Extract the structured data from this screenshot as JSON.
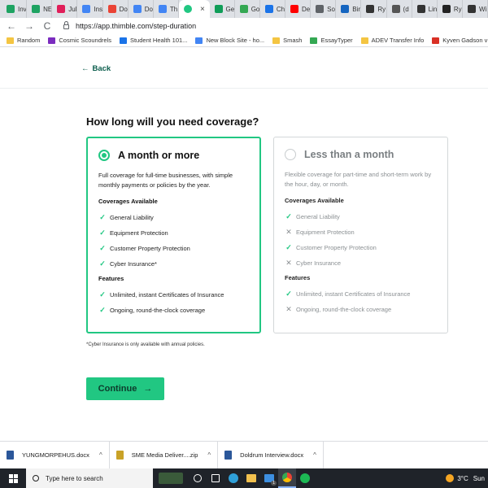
{
  "browser": {
    "tabs": [
      {
        "label": "Inv",
        "color": "#1ea362"
      },
      {
        "label": "NE",
        "color": "#1ea362"
      },
      {
        "label": "Jul",
        "color": "#e01e5a"
      },
      {
        "label": "Ins",
        "color": "#4285f4"
      },
      {
        "label": "Do",
        "color": "#ea4335"
      },
      {
        "label": "Do",
        "color": "#4285f4"
      },
      {
        "label": "Th",
        "color": "#4285f4"
      },
      {
        "label": "",
        "color": "#21c782",
        "active": true
      },
      {
        "label": "Ge",
        "color": "#0f9d58"
      },
      {
        "label": "Go",
        "color": "#34a853"
      },
      {
        "label": "Ch",
        "color": "#1a73e8"
      },
      {
        "label": "De",
        "color": "#ff0000"
      },
      {
        "label": "So",
        "color": "#5f6368"
      },
      {
        "label": "Bir",
        "color": "#1565c0"
      },
      {
        "label": "Ry",
        "color": "#333333"
      },
      {
        "label": "(d",
        "color": "#555555"
      },
      {
        "label": "Lin",
        "color": "#333333"
      },
      {
        "label": "Ry",
        "color": "#222222"
      },
      {
        "label": "Wi",
        "color": "#333333"
      }
    ],
    "active_tab_close": "×",
    "nav_back": "←",
    "nav_forward": "→",
    "nav_reload": "C",
    "url": "https://app.thimble.com/step-duration",
    "bookmarks": [
      {
        "label": "Random",
        "color": "#f4c542"
      },
      {
        "label": "Cosmic Scoundrels",
        "color": "#7b2cbf"
      },
      {
        "label": "Student Health 101...",
        "color": "#1a73e8"
      },
      {
        "label": "New Block Site - ho...",
        "color": "#4285f4"
      },
      {
        "label": "Smash",
        "color": "#f4c542"
      },
      {
        "label": "EssayTyper",
        "color": "#34a853"
      },
      {
        "label": "ADEV Transfer Info",
        "color": "#f4c542"
      },
      {
        "label": "Kyven Gadson v Jor...",
        "color": "#d93025"
      }
    ]
  },
  "page": {
    "back_arrow": "←",
    "back_label": "Back",
    "question": "How long will you need coverage?",
    "options": [
      {
        "title": "A month or more",
        "selected": true,
        "description": "Full coverage for full-time businesses, with simple monthly payments or policies by the year.",
        "coverages_heading": "Coverages Available",
        "coverages": [
          {
            "label": "General Liability",
            "included": true
          },
          {
            "label": "Equipment Protection",
            "included": true
          },
          {
            "label": "Customer Property Protection",
            "included": true
          },
          {
            "label": "Cyber Insurance*",
            "included": true
          }
        ],
        "features_heading": "Features",
        "features": [
          {
            "label": "Unlimited, instant Certificates of Insurance",
            "included": true
          },
          {
            "label": "Ongoing, round-the-clock coverage",
            "included": true
          }
        ]
      },
      {
        "title": "Less than a month",
        "selected": false,
        "description": "Flexible coverage for part-time and short-term work by the hour, day, or month.",
        "coverages_heading": "Coverages Available",
        "coverages": [
          {
            "label": "General Liability",
            "included": true
          },
          {
            "label": "Equipment Protection",
            "included": false
          },
          {
            "label": "Customer Property Protection",
            "included": true
          },
          {
            "label": "Cyber Insurance",
            "included": false
          }
        ],
        "features_heading": "Features",
        "features": [
          {
            "label": "Unlimited, instant Certificates of Insurance",
            "included": true
          },
          {
            "label": "Ongoing, round-the-clock coverage",
            "included": false
          }
        ]
      }
    ],
    "check_glyph": "✓",
    "x_glyph": "✕",
    "footnote": "*Cyber Insurance is only available with annual policies.",
    "continue_label": "Continue",
    "continue_arrow": "→",
    "accent_color": "#21c782"
  },
  "downloads": [
    {
      "name": "YUNGMORPEHUS.docx",
      "color": "#2b579a"
    },
    {
      "name": "SME Media Deliver....zip",
      "color": "#c9a227"
    },
    {
      "name": "Doldrum Interview.docx",
      "color": "#2b579a"
    }
  ],
  "download_caret": "^",
  "taskbar": {
    "search_placeholder": "Type here to search",
    "temperature": "3°C",
    "day": "Sun",
    "mail_badge": "1"
  }
}
